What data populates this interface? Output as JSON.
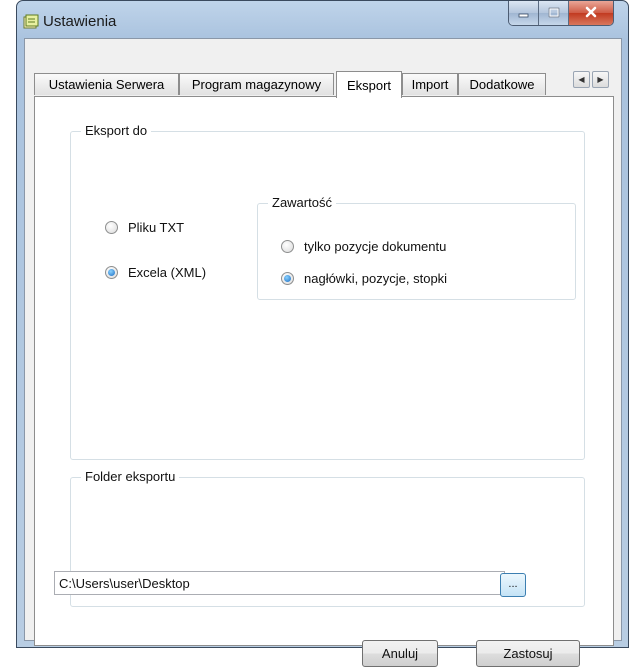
{
  "window": {
    "title": "Ustawienia",
    "app_icon": "settings-app-icon",
    "controls": {
      "minimize_icon": "minimize-icon",
      "maximize_icon": "maximize-icon",
      "close_icon": "close-icon"
    }
  },
  "tabs": [
    {
      "label": "Ustawienia Serwera",
      "active": false
    },
    {
      "label": "Program magazynowy",
      "active": false
    },
    {
      "label": "Eksport",
      "active": true
    },
    {
      "label": "Import",
      "active": false
    },
    {
      "label": "Dodatkowe",
      "active": false
    }
  ],
  "export_group": {
    "label": "Eksport do",
    "options": [
      {
        "label": "Pliku TXT",
        "selected": false
      },
      {
        "label": "Excela (XML)",
        "selected": true
      }
    ]
  },
  "content_group": {
    "label": "Zawartość",
    "options": [
      {
        "label": "tylko pozycje dokumentu",
        "selected": false
      },
      {
        "label": "nagłówki, pozycje,  stopki",
        "selected": true
      }
    ]
  },
  "folder_group": {
    "label": "Folder eksportu",
    "path": "C:\\Users\\user\\Desktop",
    "browse_label": "..."
  },
  "buttons": {
    "cancel": "Anuluj",
    "apply": "Zastosuj"
  },
  "colors": {
    "accent": "#1a6cc2",
    "title_bar": "#a9c2de",
    "close": "#c23a21"
  }
}
